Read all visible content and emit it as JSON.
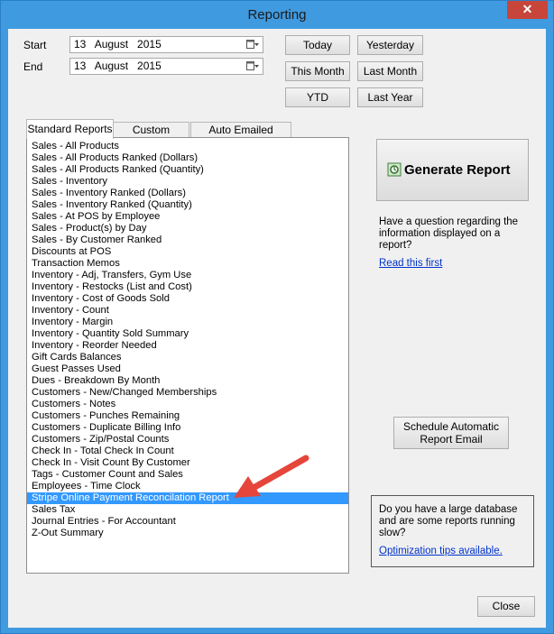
{
  "window": {
    "title": "Reporting",
    "close_glyph": "✕"
  },
  "dates": {
    "start_label": "Start",
    "start_value": "13   August   2015",
    "end_label": "End",
    "end_value": "13   August   2015"
  },
  "quick_buttons": {
    "today": "Today",
    "yesterday": "Yesterday",
    "this_month": "This Month",
    "last_month": "Last Month",
    "ytd": "YTD",
    "last_year": "Last Year"
  },
  "tabs": [
    "Standard Reports",
    "Custom Reports",
    "Auto Emailed Reports"
  ],
  "reports": [
    "Sales - All Products",
    "Sales - All Products Ranked (Dollars)",
    "Sales - All Products Ranked (Quantity)",
    "Sales - Inventory",
    "Sales - Inventory Ranked (Dollars)",
    "Sales - Inventory Ranked (Quantity)",
    "Sales - At POS by Employee",
    "Sales - Product(s) by Day",
    "Sales - By Customer Ranked",
    "Discounts at POS",
    "Transaction Memos",
    "Inventory - Adj, Transfers, Gym Use",
    "Inventory - Restocks (List and Cost)",
    "Inventory - Cost of Goods Sold",
    "Inventory - Count",
    "Inventory - Margin",
    "Inventory - Quantity Sold Summary",
    "Inventory - Reorder Needed",
    "Gift Cards Balances",
    "Guest Passes Used",
    "Dues - Breakdown By Month",
    "Customers - New/Changed Memberships",
    "Customers - Notes",
    "Customers - Punches Remaining",
    "Customers - Duplicate Billing Info",
    "Customers - Zip/Postal Counts",
    "Check In - Total Check In Count",
    "Check In - Visit Count By Customer",
    "Tags - Customer Count and Sales",
    "Employees - Time Clock",
    "Stripe Online Payment Reconcilation Report",
    "Sales Tax",
    "Journal Entries - For Accountant",
    "Z-Out Summary"
  ],
  "selected_report_index": 30,
  "generate_label": "Generate Report",
  "question_text": "Have a question regarding the information displayed on a report?",
  "read_link": "Read this first",
  "schedule_label_1": "Schedule Automatic",
  "schedule_label_2": "Report Email",
  "info_text": "Do you have a large database and are some reports running slow?",
  "tips_link": "Optimization tips available.",
  "close_label": "Close",
  "colors": {
    "titlebar": "#3f9ae0",
    "selection": "#3399ff",
    "arrow": "#e5453b",
    "link": "#0033cc"
  }
}
